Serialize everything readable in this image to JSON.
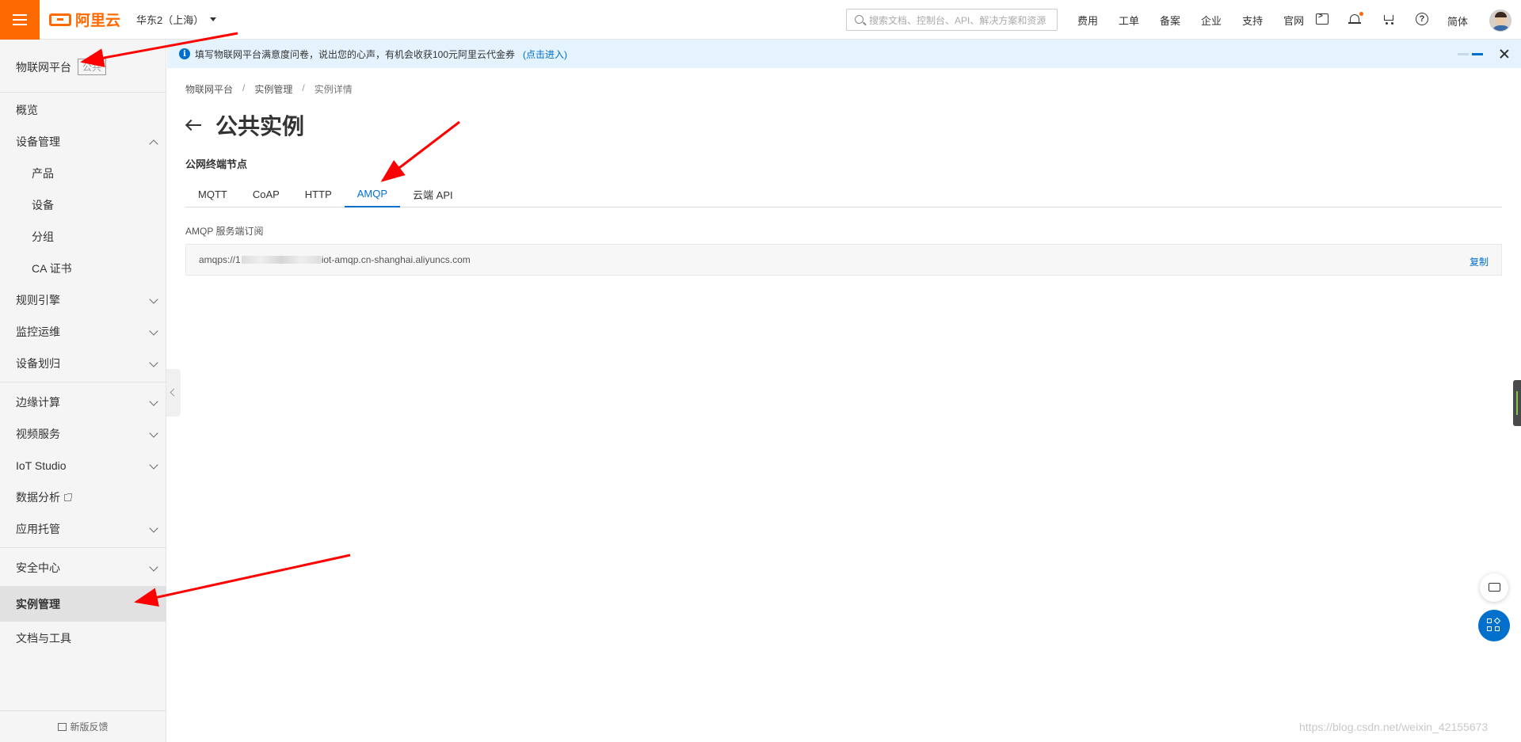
{
  "topbar": {
    "logo_text": "阿里云",
    "region": "华东2（上海）",
    "search_placeholder": "搜索文档、控制台、API、解决方案和资源",
    "nav": [
      "费用",
      "工单",
      "备案",
      "企业",
      "支持",
      "官网"
    ],
    "lang": "简体"
  },
  "sidebar": {
    "title": "物联网平台",
    "title_badge": "公共",
    "items": [
      {
        "label": "概览"
      },
      {
        "label": "设备管理"
      },
      {
        "label": "产品"
      },
      {
        "label": "设备"
      },
      {
        "label": "分组"
      },
      {
        "label": "CA 证书"
      },
      {
        "label": "规则引擎"
      },
      {
        "label": "监控运维"
      },
      {
        "label": "设备划归"
      },
      {
        "label": "边缘计算"
      },
      {
        "label": "视频服务"
      },
      {
        "label": "IoT Studio"
      },
      {
        "label": "数据分析"
      },
      {
        "label": "应用托管"
      },
      {
        "label": "安全中心"
      },
      {
        "label": "实例管理"
      },
      {
        "label": "文档与工具"
      }
    ],
    "feedback": "新版反馈"
  },
  "notice": {
    "text": "填写物联网平台满意度问卷，说出您的心声，有机会收获100元阿里云代金券",
    "link": "(点击进入)"
  },
  "breadcrumb": [
    "物联网平台",
    "实例管理",
    "实例详情"
  ],
  "page": {
    "title": "公共实例",
    "section_title": "公网终端节点",
    "tabs": [
      "MQTT",
      "CoAP",
      "HTTP",
      "AMQP",
      "云端 API"
    ],
    "active_tab": "AMQP",
    "field_label": "AMQP 服务端订阅",
    "endpoint_prefix": "amqps://1",
    "endpoint_suffix": "iot-amqp.cn-shanghai.aliyuncs.com",
    "copy_label": "复制"
  },
  "watermark": "https://blog.csdn.net/weixin_42155673",
  "colors": {
    "brand": "#ff6a00",
    "link": "#0070cc",
    "annotation": "#ff0000"
  }
}
